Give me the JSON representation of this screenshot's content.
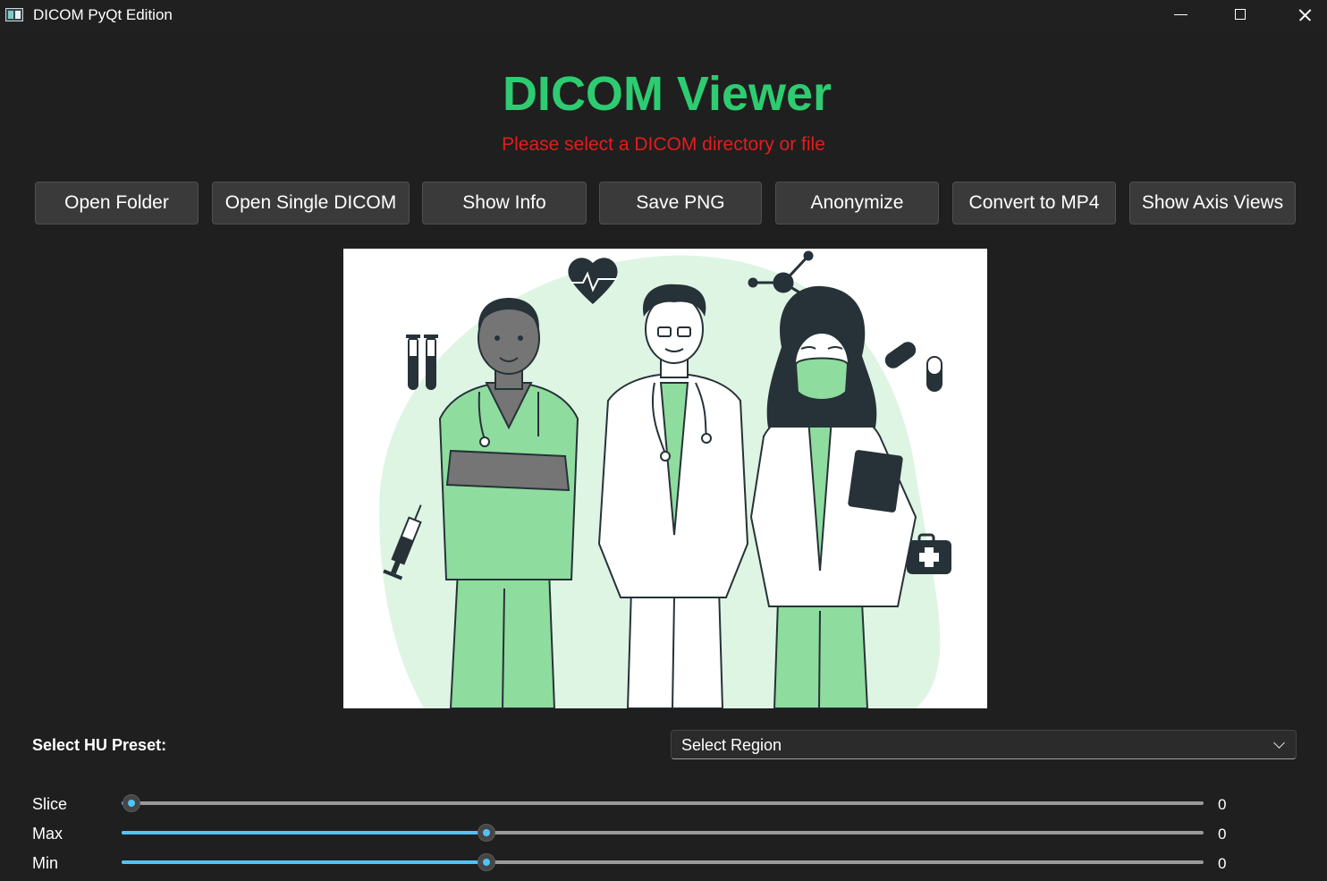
{
  "window": {
    "title": "DICOM PyQt Edition"
  },
  "header": {
    "title": "DICOM Viewer",
    "status": "Please select a DICOM directory or file",
    "title_color": "#2ecc71",
    "status_color": "#e51c1c"
  },
  "toolbar": {
    "buttons": [
      {
        "label": "Open Folder"
      },
      {
        "label": "Open Single DICOM"
      },
      {
        "label": "Show Info"
      },
      {
        "label": "Save PNG"
      },
      {
        "label": "Anonymize"
      },
      {
        "label": "Convert to MP4"
      },
      {
        "label": "Show Axis Views"
      }
    ]
  },
  "viewer": {
    "placeholder_image": "medical-staff-illustration",
    "accent_color": "#8fdc9f"
  },
  "hu_preset": {
    "label": "Select HU Preset:",
    "selected": "Select Region"
  },
  "sliders": [
    {
      "label": "Slice",
      "value": "0",
      "fraction": 0.009
    },
    {
      "label": "Max",
      "value": "0",
      "fraction": 0.337
    },
    {
      "label": "Min",
      "value": "0",
      "fraction": 0.337
    }
  ],
  "colors": {
    "background": "#1f1f1f",
    "button_bg": "#3a3a3a",
    "slider_accent": "#4fc3f7"
  }
}
